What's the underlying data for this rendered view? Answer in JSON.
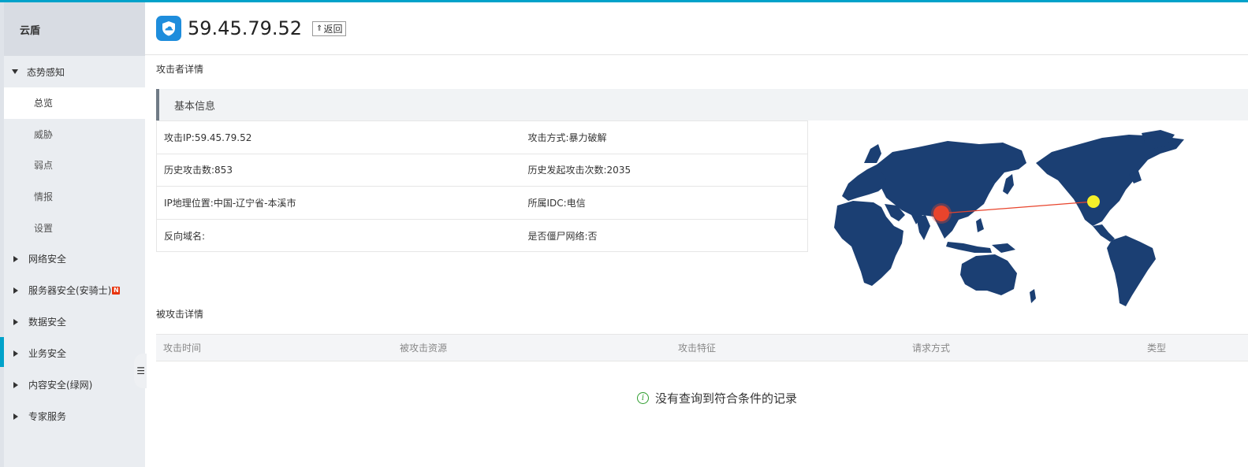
{
  "colors": {
    "accent": "#00a2ca",
    "shield": "#1e8ddc",
    "map_land": "#1b3f73",
    "source_point": "#e8442c",
    "target_point": "#f5f02a",
    "badge": "#e8340d"
  },
  "sidebar": {
    "title": "云盾",
    "groups": [
      {
        "label": "态势感知",
        "expanded": true,
        "items": [
          {
            "label": "总览"
          },
          {
            "label": "威胁"
          },
          {
            "label": "弱点"
          },
          {
            "label": "情报"
          },
          {
            "label": "设置"
          }
        ]
      },
      {
        "label": "网络安全"
      },
      {
        "label": "服务器安全(安骑士)",
        "badge": "N"
      },
      {
        "label": "数据安全"
      },
      {
        "label": "业务安全"
      },
      {
        "label": "内容安全(绿网)"
      },
      {
        "label": "专家服务"
      }
    ],
    "collapse_icon": "menu-icon"
  },
  "header": {
    "ip": "59.45.79.52",
    "back_label": "返回",
    "icon": "shield-icon"
  },
  "attacker_section": {
    "title": "攻击者详情"
  },
  "basic_info": {
    "title": "基本信息",
    "rows": [
      {
        "left": "攻击IP:59.45.79.52",
        "right": "攻击方式:暴力破解"
      },
      {
        "left": "历史攻击数:853",
        "right": "历史发起攻击次数:2035"
      },
      {
        "left": "IP地理位置:中国-辽宁省-本溪市",
        "right": "所属IDC:电信"
      },
      {
        "left": "反向域名:",
        "right": "是否僵尸网络:否"
      }
    ]
  },
  "attacked_section": {
    "title": "被攻击详情",
    "columns": [
      "攻击时间",
      "被攻击资源",
      "攻击特征",
      "请求方式",
      "类型"
    ],
    "empty_text": "没有查询到符合条件的记录"
  }
}
